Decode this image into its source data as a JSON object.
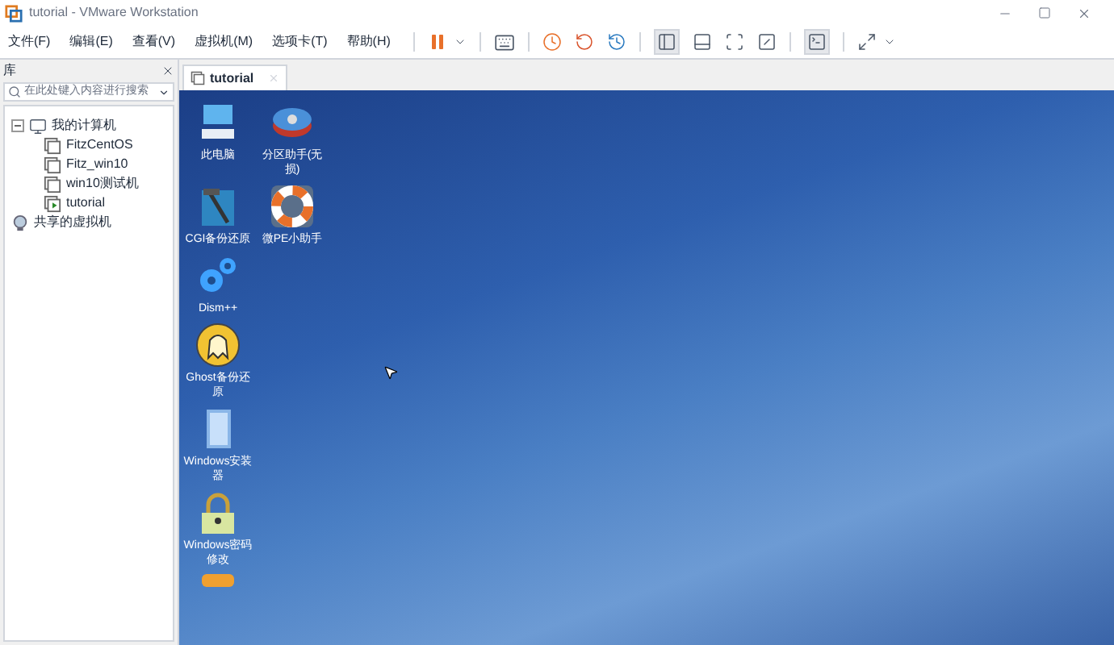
{
  "window": {
    "title": "tutorial - VMware Workstation"
  },
  "menu": [
    "文件(F)",
    "编辑(E)",
    "查看(V)",
    "虚拟机(M)",
    "选项卡(T)",
    "帮助(H)"
  ],
  "library": {
    "title": "库",
    "search": {
      "placeholder": "在此处键入内容进行搜索"
    },
    "tree": [
      {
        "label": "我的计算机",
        "kind": "computer",
        "expanded": true,
        "children": [
          {
            "label": "FitzCentOS",
            "kind": "vm"
          },
          {
            "label": "Fitz_win10",
            "kind": "vm"
          },
          {
            "label": "win10测试机",
            "kind": "vm"
          },
          {
            "label": "tutorial",
            "kind": "vm-running"
          }
        ]
      },
      {
        "label": "共享的虚拟机",
        "kind": "shared"
      }
    ]
  },
  "tabs": [
    {
      "label": "tutorial",
      "selected": true
    }
  ],
  "desktop": {
    "icon_rows": [
      {
        "icons": [
          {
            "label": "此电脑",
            "kind": "pc"
          },
          {
            "label": "分区助手(无损)",
            "kind": "disk"
          }
        ]
      },
      {
        "icons": [
          {
            "label": "CGI备份还原",
            "kind": "cgi"
          },
          {
            "label": "微PE小助手",
            "kind": "lifebuoy"
          }
        ]
      },
      {
        "icons": [
          {
            "label": "Dism++",
            "kind": "gears"
          }
        ]
      },
      {
        "icons": [
          {
            "label": "Ghost备份还原",
            "kind": "ghost"
          }
        ]
      },
      {
        "icons": [
          {
            "label": "Windows安装器",
            "kind": "book"
          }
        ]
      },
      {
        "icons": [
          {
            "label": "Windows密码修改",
            "kind": "lock"
          }
        ]
      },
      {
        "icons": [
          {
            "kind": "partial"
          }
        ]
      }
    ]
  }
}
